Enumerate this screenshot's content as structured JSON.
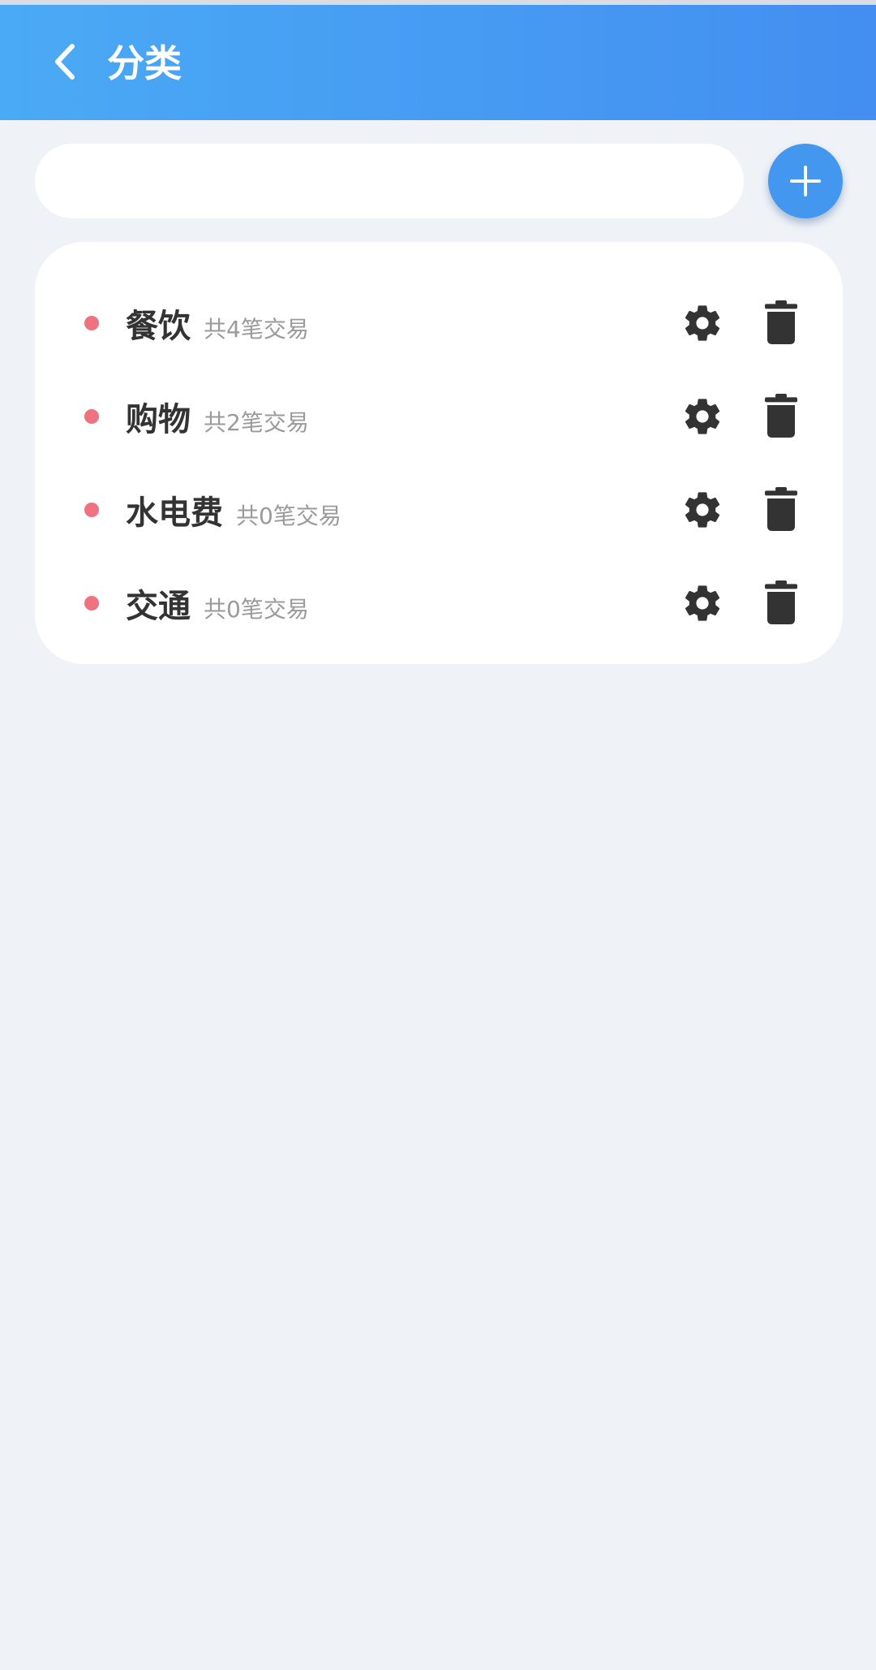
{
  "header": {
    "title": "分类",
    "back_icon": "chevron-left-icon",
    "background_start": "#4aaaf5",
    "background_end": "#438ef0"
  },
  "search": {
    "value": "",
    "placeholder": ""
  },
  "add_button": {
    "icon": "plus-icon",
    "color": "#4497ee"
  },
  "categories": [
    {
      "name": "餐饮",
      "count_text": "共4笔交易",
      "dot_color": "#f0717f"
    },
    {
      "name": "购物",
      "count_text": "共2笔交易",
      "dot_color": "#f0717f"
    },
    {
      "name": "水电费",
      "count_text": "共0笔交易",
      "dot_color": "#f0717f"
    },
    {
      "name": "交通",
      "count_text": "共0笔交易",
      "dot_color": "#f0717f"
    }
  ],
  "row_icons": {
    "settings": "gear-icon",
    "delete": "trash-icon"
  }
}
